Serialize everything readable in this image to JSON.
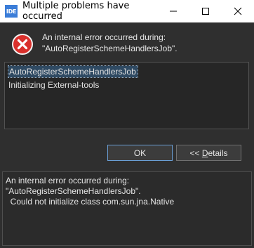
{
  "window": {
    "app_icon_text": "IDE",
    "title": "Multiple problems have occurred"
  },
  "message": {
    "line1": "An internal error occurred during:",
    "line2": "\"AutoRegisterSchemeHandlersJob\"."
  },
  "problems": [
    {
      "label": "AutoRegisterSchemeHandlersJob",
      "selected": true
    },
    {
      "label": "Initializing External-tools",
      "selected": false
    }
  ],
  "buttons": {
    "ok": "OK",
    "details_prefix": "<< ",
    "details_mnemonic": "D",
    "details_rest": "etails"
  },
  "details": {
    "line1": "An internal error occurred during:",
    "line2": "\"AutoRegisterSchemeHandlersJob\".",
    "line3": "  Could not initialize class com.sun.jna.Native"
  },
  "colors": {
    "background": "#2f2f2f",
    "error_red": "#d9302c",
    "selection": "#2f4a63"
  }
}
